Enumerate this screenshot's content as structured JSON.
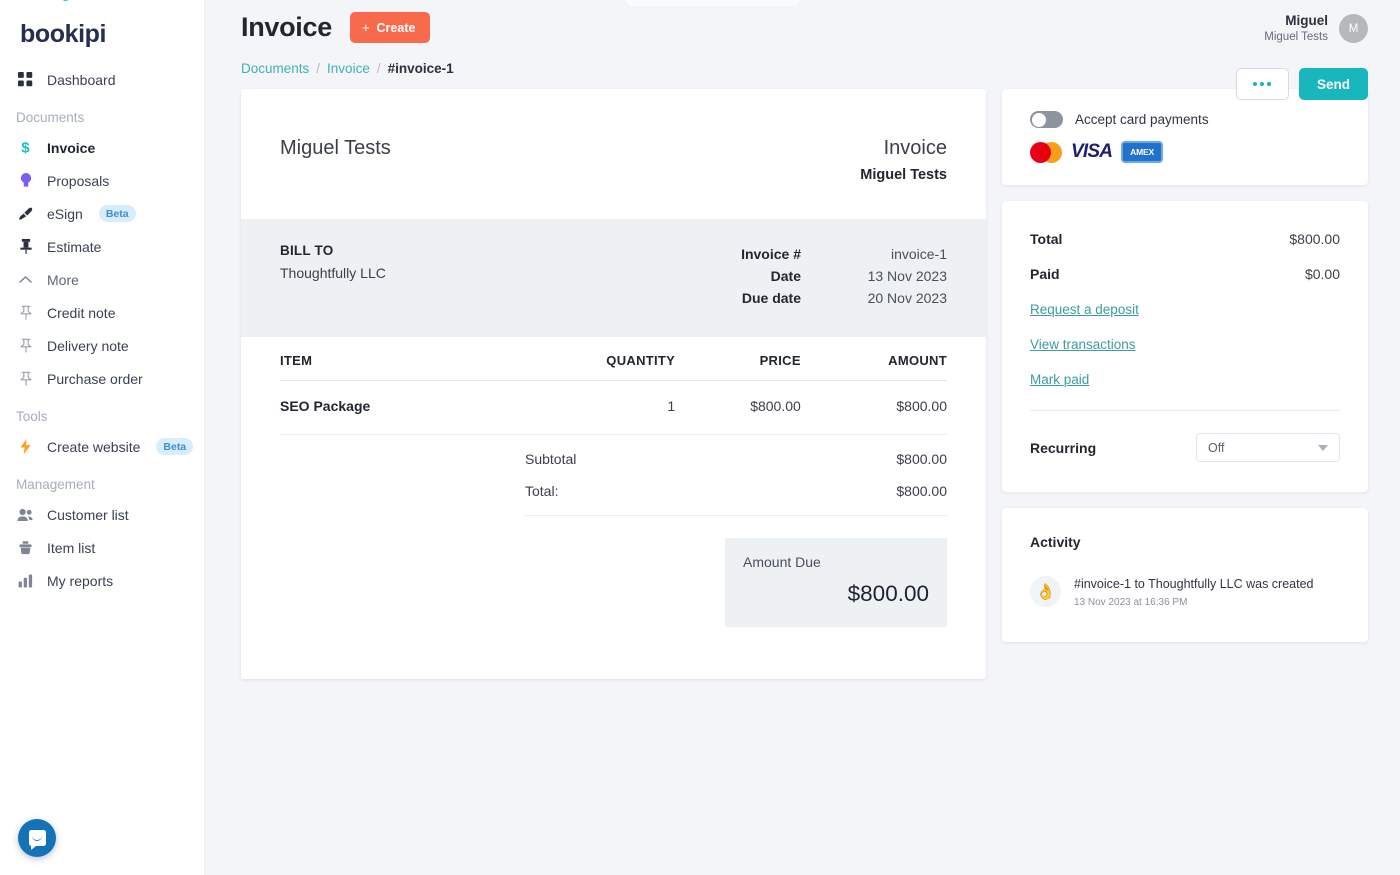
{
  "brand": {
    "logo": "bookipi",
    "accent_teal": "#18b6bd",
    "accent_orange": "#f96a4d"
  },
  "sidebar": {
    "top_items": [
      {
        "label": "Dashboard",
        "icon": "grid-icon"
      }
    ],
    "groups": [
      {
        "label": "Documents",
        "items": [
          {
            "label": "Invoice",
            "icon": "dollar-icon",
            "active": true
          },
          {
            "label": "Proposals",
            "icon": "lightbulb-icon",
            "active": false
          },
          {
            "label": "eSign",
            "icon": "pen-icon",
            "badge": "Beta",
            "active": false
          },
          {
            "label": "Estimate",
            "icon": "pin-icon",
            "active": false
          },
          {
            "label": "More",
            "icon": "chevron-up-icon",
            "active": false
          },
          {
            "label": "Credit note",
            "icon": "pin-outline-icon",
            "active": false
          },
          {
            "label": "Delivery note",
            "icon": "pin-outline-icon",
            "active": false
          },
          {
            "label": "Purchase order",
            "icon": "pin-outline-icon",
            "active": false
          }
        ]
      },
      {
        "label": "Tools",
        "items": [
          {
            "label": "Create website",
            "icon": "bolt-icon",
            "badge": "Beta",
            "active": false
          }
        ]
      },
      {
        "label": "Management",
        "items": [
          {
            "label": "Customer list",
            "icon": "people-icon",
            "active": false
          },
          {
            "label": "Item list",
            "icon": "box-icon",
            "active": false
          },
          {
            "label": "My reports",
            "icon": "bars-icon",
            "active": false
          }
        ]
      }
    ]
  },
  "header": {
    "title": "Invoice",
    "create_label": "Create",
    "create_plus": "+",
    "user": {
      "name": "Miguel",
      "company": "Miguel Tests",
      "initial": "M"
    },
    "breadcrumb": [
      {
        "label": "Documents",
        "current": false
      },
      {
        "label": "Invoice",
        "current": false
      },
      {
        "label": "#invoice-1",
        "current": true
      }
    ],
    "breadcrumb_separator": "/",
    "more_label": "",
    "send_label": "Send"
  },
  "invoice": {
    "business_name": "Miguel Tests",
    "doc_kind": "Invoice",
    "doc_kind_sub": "Miguel Tests",
    "bill_to_label": "BILL TO",
    "bill_to_value": "Thoughtfully LLC",
    "meta": [
      {
        "key": "Invoice #",
        "value": "invoice-1"
      },
      {
        "key": "Date",
        "value": "13 Nov 2023"
      },
      {
        "key": "Due date",
        "value": "20 Nov 2023"
      }
    ],
    "table": {
      "headers": [
        "ITEM",
        "QUANTITY",
        "PRICE",
        "AMOUNT"
      ],
      "rows": [
        {
          "item": "SEO Package",
          "quantity": "1",
          "price": "$800.00",
          "amount": "$800.00"
        }
      ]
    },
    "summary": [
      {
        "key": "Subtotal",
        "value": "$800.00"
      },
      {
        "key": "Total:",
        "value": "$800.00"
      }
    ],
    "amount_due_label": "Amount Due",
    "amount_due_value": "$800.00"
  },
  "rail": {
    "payments": {
      "toggle_label": "Accept card payments",
      "toggle_on": false,
      "card_brands": [
        "mastercard-logo",
        "visa-logo",
        "amex-logo"
      ],
      "visa_text": "VISA",
      "amex_text": "AMEX"
    },
    "totals": {
      "rows": [
        {
          "key": "Total",
          "value": "$800.00"
        },
        {
          "key": "Paid",
          "value": "$0.00"
        }
      ],
      "links": [
        "Request a deposit",
        "View transactions",
        "Mark paid"
      ],
      "recurring_label": "Recurring",
      "recurring_value": "Off"
    },
    "activity": {
      "title": "Activity",
      "items": [
        {
          "emoji": "👌",
          "text": "#invoice-1 to Thoughtfully LLC was created",
          "time": "13 Nov 2023 at 16:36 PM"
        }
      ]
    }
  },
  "chat": {
    "name": "messenger-launcher"
  }
}
